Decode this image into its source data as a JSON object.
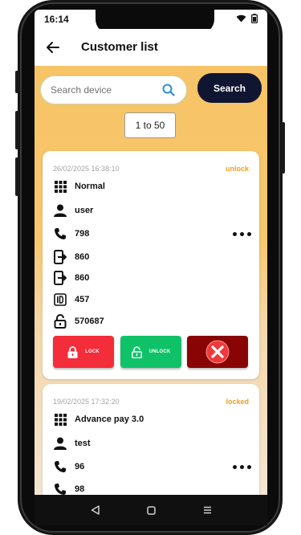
{
  "status_bar": {
    "time": "16:14"
  },
  "app_bar": {
    "title": "Customer list"
  },
  "search": {
    "placeholder": "Search device",
    "button_label": "Search"
  },
  "pagination": {
    "range_label": "1 to 50"
  },
  "colors": {
    "accent": "#f7c265",
    "search_button": "#101632",
    "lock": "#f32d39",
    "unlock": "#0fc268",
    "delete": "#880405",
    "status": "#f0a017"
  },
  "cards": [
    {
      "date": "26/02/2025 16:38:10",
      "status": "unlock",
      "plan": "Normal",
      "user": "user",
      "phone": "798",
      "device_1": "860",
      "device_2": "860",
      "code": "457",
      "pin": "570687",
      "lock_label": "LOCK",
      "unlock_label": "UNLOCK"
    },
    {
      "date": "19/02/2025 17:32:20",
      "status": "locked",
      "plan": "Advance pay 3.0",
      "user": "test",
      "phone": "96",
      "phone_2": "98"
    }
  ]
}
